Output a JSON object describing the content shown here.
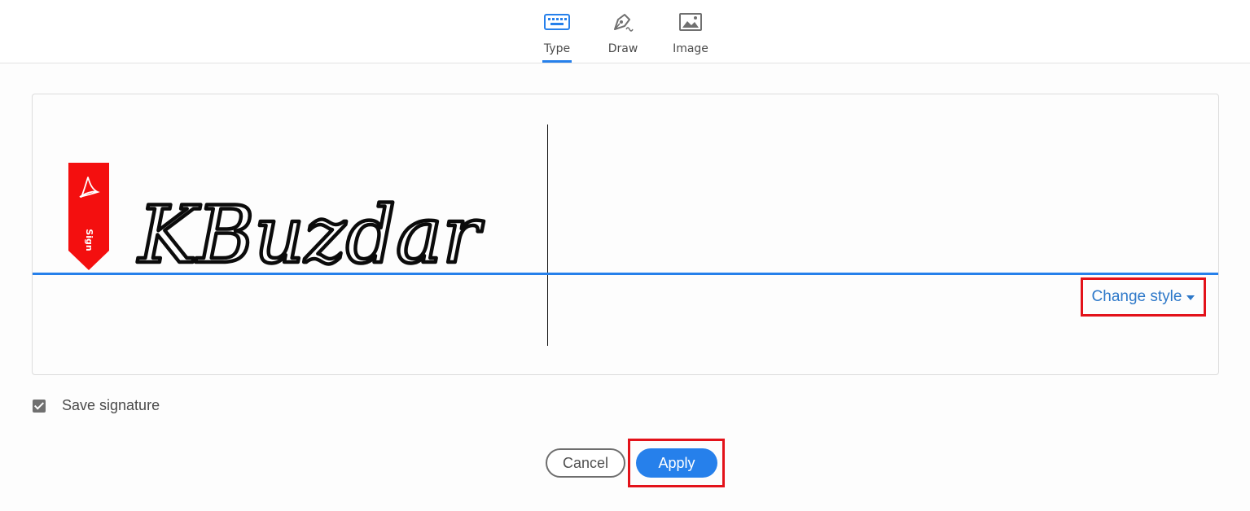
{
  "tabs": [
    {
      "label": "Type",
      "icon": "keyboard-icon",
      "active": true
    },
    {
      "label": "Draw",
      "icon": "pen-icon",
      "active": false
    },
    {
      "label": "Image",
      "icon": "image-icon",
      "active": false
    }
  ],
  "signature": {
    "text": "KBuzdar",
    "tag_label": "Sign",
    "tag_icon": "acrobat-logo-icon",
    "change_style_label": "Change style"
  },
  "options": {
    "save_signature_label": "Save signature",
    "save_signature_checked": true
  },
  "actions": {
    "cancel_label": "Cancel",
    "apply_label": "Apply"
  },
  "colors": {
    "accent": "#2680eb",
    "highlight": "#e3121a",
    "sign_tag": "#f40f0f"
  }
}
